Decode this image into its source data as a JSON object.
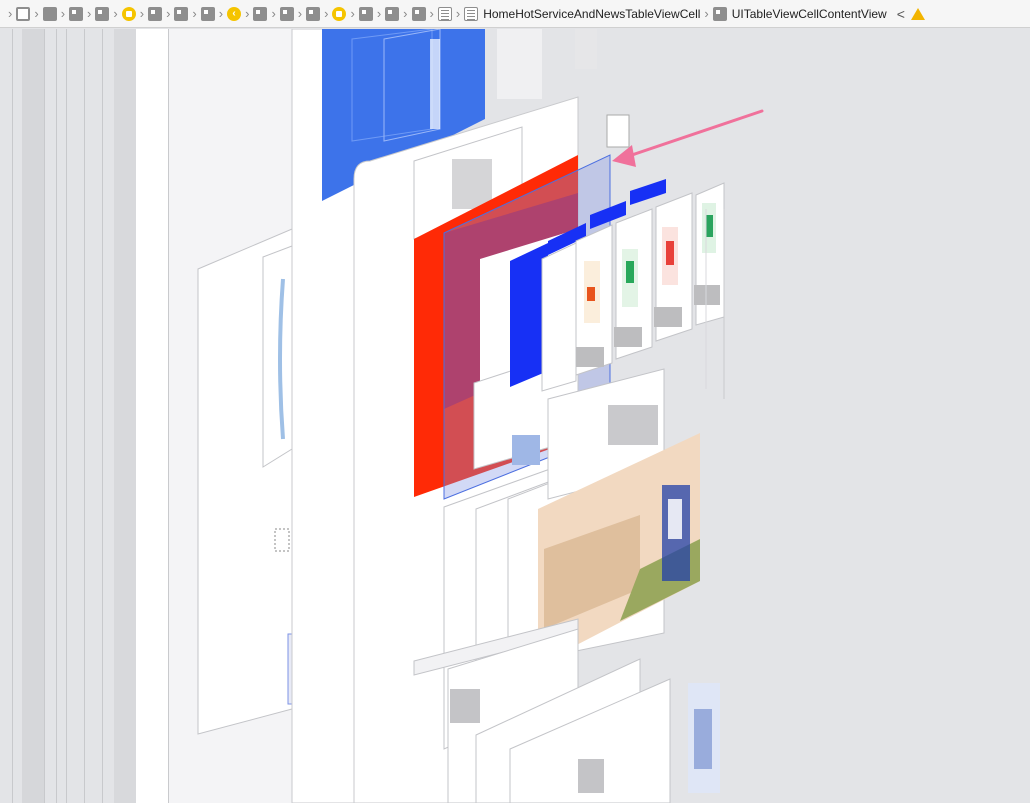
{
  "jumpbar": {
    "crumbs": [
      {
        "icon": "view-icon"
      },
      {
        "icon": "view-dark-icon"
      },
      {
        "icon": "view-icon"
      },
      {
        "icon": "view-icon"
      },
      {
        "icon": "view-controller-icon"
      },
      {
        "icon": "view-icon"
      },
      {
        "icon": "view-icon"
      },
      {
        "icon": "view-icon"
      },
      {
        "icon": "navigation-back-icon"
      },
      {
        "icon": "view-icon"
      },
      {
        "icon": "view-icon"
      },
      {
        "icon": "view-icon"
      },
      {
        "icon": "view-controller-icon"
      },
      {
        "icon": "view-icon"
      },
      {
        "icon": "view-icon"
      },
      {
        "icon": "view-icon"
      },
      {
        "icon": "table-view-icon"
      }
    ],
    "cell_label": "HomeHotServiceAndNewsTableViewCell",
    "content_label": "UITableViewCellContentView",
    "back_glyph": "<",
    "colors": {
      "accent_yellow": "#f5c400",
      "warning": "#f2b400"
    }
  },
  "scene": {
    "colors": {
      "background": "#e3e4e7",
      "blue_header": "#3d73ea",
      "red_block": "#ff2a06",
      "crimson_block": "#c8172f",
      "deep_blue": "#1730f5",
      "arrow": "#f0719b",
      "selection": "#7d93e6"
    },
    "selected_layer": "UITableViewCellContentView"
  }
}
